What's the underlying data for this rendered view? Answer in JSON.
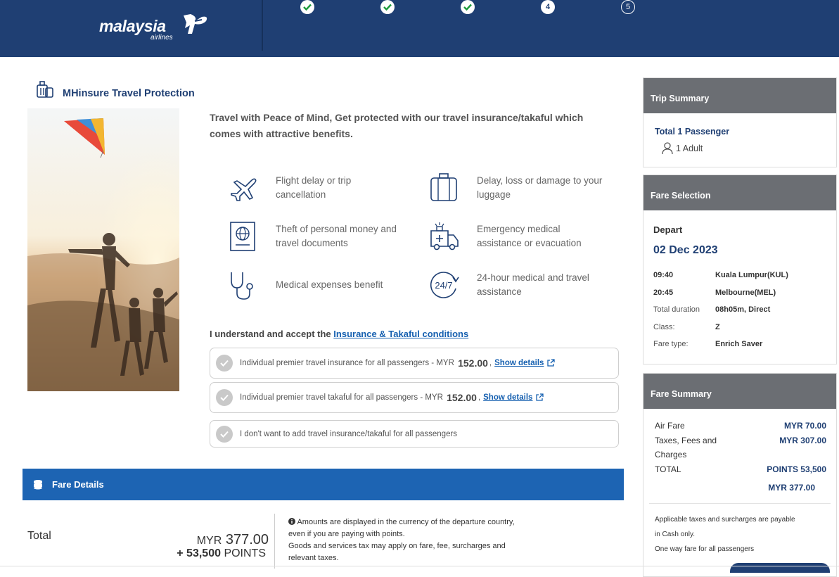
{
  "brand": {
    "name": "malaysia",
    "sub": "airlines"
  },
  "steps": [
    {
      "label": "",
      "state": "done"
    },
    {
      "label": "",
      "state": "done"
    },
    {
      "label": "",
      "state": "done"
    },
    {
      "label": "4",
      "state": "current"
    },
    {
      "label": "5",
      "state": "future"
    }
  ],
  "insurance": {
    "title": "MHinsure Travel Protection",
    "intro": "Travel with Peace of Mind, Get protected with our travel insurance/takaful which comes with attractive benefits.",
    "benefits": [
      {
        "icon": "airplane-icon",
        "line1": "Flight delay or trip",
        "line2": "cancellation"
      },
      {
        "icon": "luggage-icon",
        "line1": "Delay, loss or damage to your",
        "line2": "luggage"
      },
      {
        "icon": "passport-icon",
        "line1": "Theft of personal money and",
        "line2": "travel documents"
      },
      {
        "icon": "ambulance-icon",
        "line1": "Emergency medical",
        "line2": "assistance or evacuation"
      },
      {
        "icon": "stethoscope-icon",
        "line1": "Medical expenses benefit",
        "line2": ""
      },
      {
        "icon": "24-7-icon",
        "line1": "24-hour medical and travel",
        "line2": "assistance"
      }
    ],
    "accept_prefix": "I understand and accept the",
    "accept_link": "Insurance & Takaful conditions",
    "options": [
      {
        "text": "Individual premier travel insurance  for all passengers - MYR",
        "price": "152.00",
        "suffix": ",",
        "link": "Show details"
      },
      {
        "text": "Individual premier travel takaful  for all passengers - MYR",
        "price": "152.00",
        "suffix": ",",
        "link": "Show details"
      },
      {
        "text": "I don't want to add travel insurance/takaful  for all passengers",
        "price": "",
        "suffix": "",
        "link": ""
      }
    ]
  },
  "fare_details": {
    "title": "Fare Details",
    "total_label": "Total",
    "total_currency": "MYR",
    "total_amount": "377.00",
    "points_prefix": "+",
    "points_amount": "53,500",
    "points_label": "POINTS",
    "notes": [
      "Amounts are displayed in the currency of the departure country, even if you are paying with points.",
      "Goods and services tax may apply on fare, fee, surcharges and relevant taxes."
    ]
  },
  "trip_summary": {
    "title": "Trip Summary",
    "passengers": "Total 1 Passenger",
    "adult": "1 Adult"
  },
  "fare_selection": {
    "title": "Fare Selection",
    "direction": "Depart",
    "date": "02 Dec 2023",
    "rows": [
      {
        "k": "09:40",
        "v": "Kuala Lumpur(KUL)",
        "bold": true
      },
      {
        "k": "20:45",
        "v": "Melbourne(MEL)",
        "bold": true
      },
      {
        "k": "Total duration",
        "v": "08h05m, Direct",
        "bold": false
      },
      {
        "k": "Class:",
        "v": "Z",
        "bold": false
      },
      {
        "k": "Fare type:",
        "v": "Enrich Saver",
        "bold": false
      }
    ]
  },
  "fare_summary": {
    "title": "Fare Summary",
    "air_fare_label": "Air Fare",
    "air_fare_value": "MYR 70.00",
    "taxes_label": "Taxes, Fees and Charges",
    "taxes_value": "MYR 307.00",
    "total_label": "TOTAL",
    "total_points": "POINTS  53,500",
    "total_myr": "MYR 377.00",
    "note1": "Applicable taxes and surcharges are payable",
    "note2": "in Cash only.",
    "note3": "One way fare for all passengers"
  }
}
